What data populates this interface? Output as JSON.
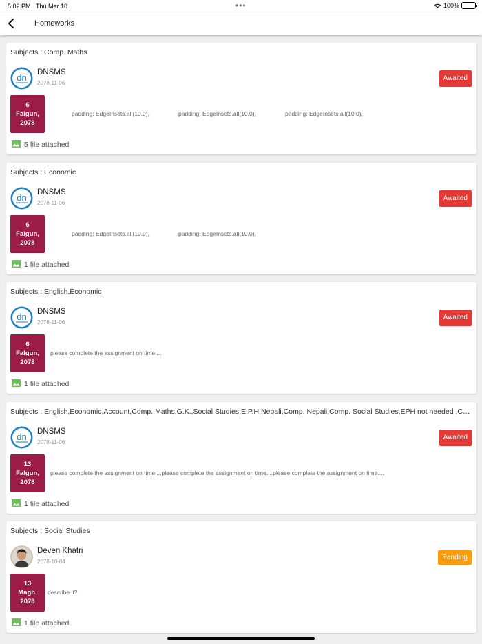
{
  "status_bar": {
    "time": "5:02 PM",
    "date": "Thu Mar 10",
    "dots": "•••",
    "battery": "100%"
  },
  "header": {
    "title": "Homeworks"
  },
  "colors": {
    "date_box": "#9b1c47",
    "awaited": "#e53935",
    "pending": "#fb9c0c",
    "attach_icon": "#6bbf59"
  },
  "homeworks": [
    {
      "subjects": "Subjects : Comp. Maths",
      "teacher": "DNSMS",
      "date": "2078-11-06",
      "status": "Awaited",
      "due": {
        "day": "6",
        "month": "Falgun,",
        "year": "2078"
      },
      "description": [
        "padding: EdgeInsets.all(10.0),",
        "padding: EdgeInsets.all(10.0),",
        "padding: EdgeInsets.all(10.0),"
      ],
      "attachments": "5 file attached"
    },
    {
      "subjects": "Subjects : Economic",
      "teacher": "DNSMS",
      "date": "2078-11-06",
      "status": "Awaited",
      "due": {
        "day": "6",
        "month": "Falgun,",
        "year": "2078"
      },
      "description": [
        "padding: EdgeInsets.all(10.0),",
        "padding: EdgeInsets.all(10.0),"
      ],
      "attachments": "1 file attached"
    },
    {
      "subjects": "Subjects : English,Economic",
      "teacher": "DNSMS",
      "date": "2078-11-06",
      "status": "Awaited",
      "due": {
        "day": "6",
        "month": "Falgun,",
        "year": "2078"
      },
      "description": [
        "please complete the assignment on time...."
      ],
      "attachments": "1 file attached"
    },
    {
      "subjects": "Subjects : English,Economic,Account,Comp. Maths,G.K.,Social Studies,E.P.H,Nepali,Comp. Nepali,Comp. Social Studies,EPH not needed ,Computer ...",
      "teacher": "DNSMS",
      "date": "2078-11-06",
      "status": "Awaited",
      "due": {
        "day": "13",
        "month": "Falgun,",
        "year": "2078"
      },
      "description": [
        "please complete the assignment on time....please complete the assignment on time....please complete the assignment on time...."
      ],
      "attachments": "1 file attached"
    },
    {
      "subjects": "Subjects : Social Studies",
      "teacher": "Deven Khatri",
      "date": "2078-10-04",
      "status": "Pending",
      "due": {
        "day": "13",
        "month": "Magh,",
        "year": "2078"
      },
      "description": [
        "describe it?"
      ],
      "attachments": "1 file attached"
    }
  ]
}
